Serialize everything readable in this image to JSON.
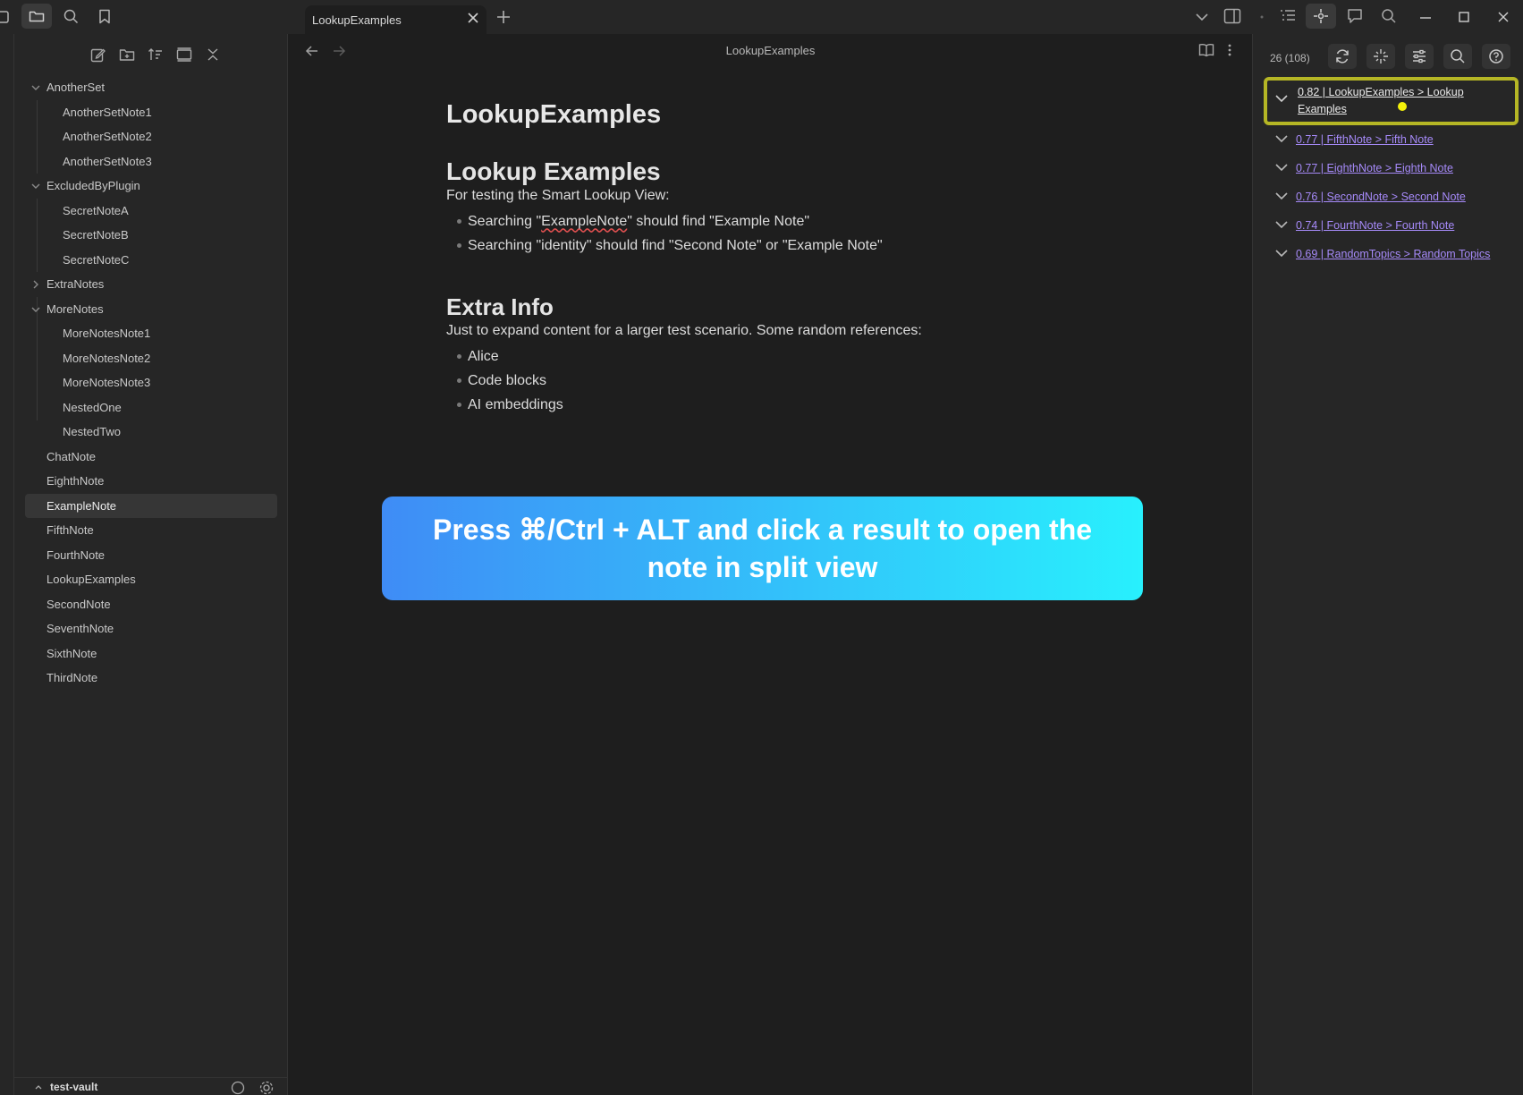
{
  "tab": {
    "title": "LookupExamples"
  },
  "sidebar": {
    "items": [
      {
        "label": "AnotherSet",
        "kind": "folder",
        "open": true
      },
      {
        "label": "AnotherSetNote1",
        "kind": "child"
      },
      {
        "label": "AnotherSetNote2",
        "kind": "child"
      },
      {
        "label": "AnotherSetNote3",
        "kind": "child"
      },
      {
        "label": "ExcludedByPlugin",
        "kind": "folder",
        "open": true
      },
      {
        "label": "SecretNoteA",
        "kind": "child"
      },
      {
        "label": "SecretNoteB",
        "kind": "child"
      },
      {
        "label": "SecretNoteC",
        "kind": "child"
      },
      {
        "label": "ExtraNotes",
        "kind": "folder",
        "open": false
      },
      {
        "label": "MoreNotes",
        "kind": "folder",
        "open": true
      },
      {
        "label": "MoreNotesNote1",
        "kind": "child"
      },
      {
        "label": "MoreNotesNote2",
        "kind": "child"
      },
      {
        "label": "MoreNotesNote3",
        "kind": "child"
      },
      {
        "label": "NestedOne",
        "kind": "child"
      },
      {
        "label": "NestedTwo",
        "kind": "child"
      },
      {
        "label": "ChatNote",
        "kind": "root"
      },
      {
        "label": "EighthNote",
        "kind": "root"
      },
      {
        "label": "ExampleNote",
        "kind": "root",
        "active": true
      },
      {
        "label": "FifthNote",
        "kind": "root"
      },
      {
        "label": "FourthNote",
        "kind": "root"
      },
      {
        "label": "LookupExamples",
        "kind": "root"
      },
      {
        "label": "SecondNote",
        "kind": "root"
      },
      {
        "label": "SeventhNote",
        "kind": "root"
      },
      {
        "label": "SixthNote",
        "kind": "root"
      },
      {
        "label": "ThirdNote",
        "kind": "root"
      }
    ],
    "vault_name": "test-vault"
  },
  "editor": {
    "header_title": "LookupExamples",
    "doc_title": "LookupExamples",
    "section1": {
      "heading": "Lookup Examples",
      "intro": "For testing the Smart Lookup View:",
      "bullet1_pre": "Searching \"",
      "bullet1_word": "ExampleNote",
      "bullet1_post": "\" should find \"Example Note\"",
      "bullet2": "Searching \"identity\" should find \"Second Note\" or \"Example Note\""
    },
    "section2": {
      "heading": "Extra Info",
      "intro": "Just to expand content for a larger test scenario. Some random references:",
      "bullets": [
        "Alice",
        "Code blocks",
        "AI embeddings"
      ]
    },
    "banner": "Press ⌘/Ctrl + ALT and click a result to open the note in split view"
  },
  "lookup": {
    "count": "26 (108)",
    "results": [
      "0.82 | LookupExamples > Lookup Examples",
      "0.77 | FifthNote > Fifth Note",
      "0.77 | EighthNote > Eighth Note",
      "0.76 | SecondNote > Second Note",
      "0.74 | FourthNote > Fourth Note",
      "0.69 | RandomTopics > Random Topics"
    ]
  },
  "colors": {
    "highlight_border": "#b5b625",
    "link": "#a68af9",
    "banner_start": "#3f8cf6",
    "banner_end": "#28f0fd",
    "cursor": "#f4f10a"
  }
}
